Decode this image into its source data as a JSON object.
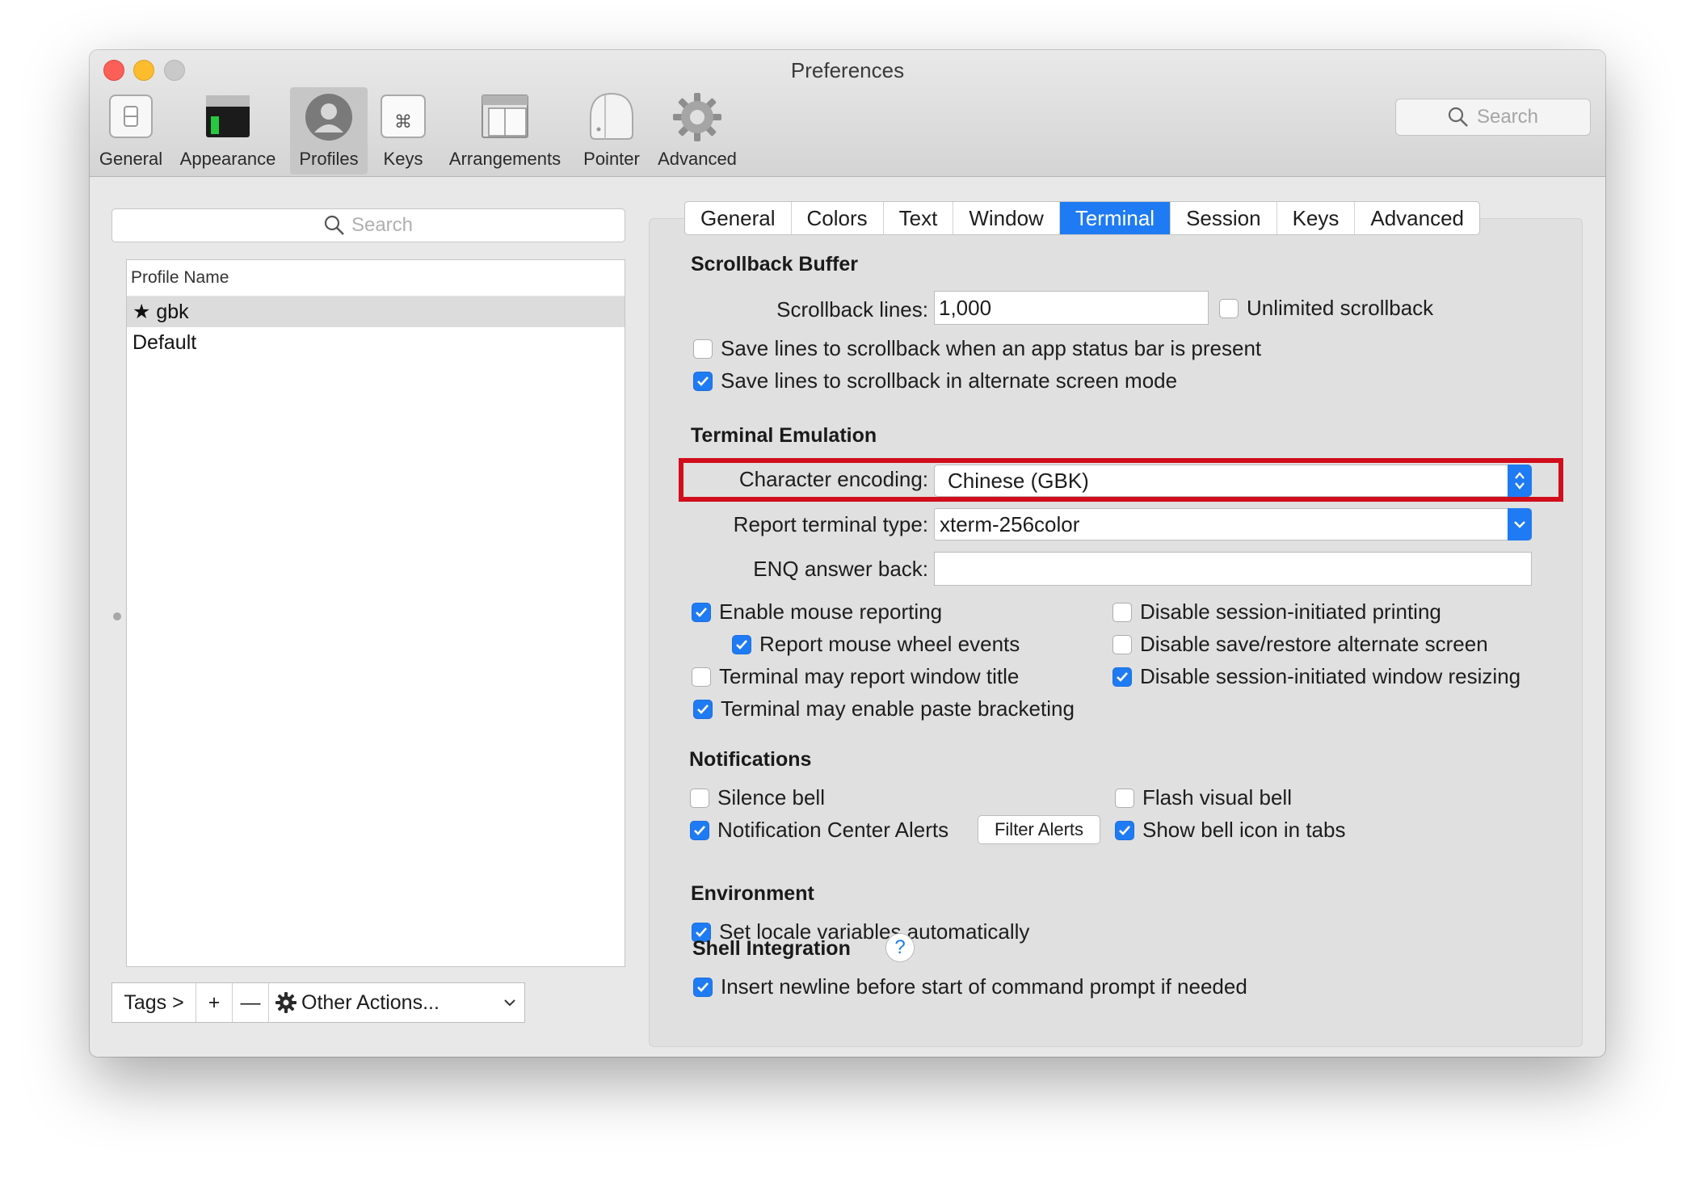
{
  "window": {
    "title": "Preferences"
  },
  "toolbar": {
    "items": [
      {
        "label": "General",
        "icon": "general-switch-icon"
      },
      {
        "label": "Appearance",
        "icon": "appearance-window-icon"
      },
      {
        "label": "Profiles",
        "icon": "profile-user-icon"
      },
      {
        "label": "Keys",
        "icon": "command-key-icon"
      },
      {
        "label": "Arrangements",
        "icon": "arrangements-windows-icon"
      },
      {
        "label": "Pointer",
        "icon": "mouse-icon"
      },
      {
        "label": "Advanced",
        "icon": "gear-icon"
      }
    ],
    "active": "Profiles",
    "search_placeholder": "Search"
  },
  "profiles": {
    "search_placeholder": "Search",
    "column_header": "Profile Name",
    "rows": [
      {
        "name": "★ gbk",
        "selected": true
      },
      {
        "name": "Default",
        "selected": false
      }
    ],
    "bottom": {
      "tags": "Tags >",
      "add": "+",
      "remove": "—",
      "other_actions": "Other Actions..."
    }
  },
  "tabs": [
    "General",
    "Colors",
    "Text",
    "Window",
    "Terminal",
    "Session",
    "Keys",
    "Advanced"
  ],
  "active_tab": "Terminal",
  "scrollback": {
    "heading": "Scrollback Buffer",
    "lines_label": "Scrollback lines:",
    "lines_value": "1,000",
    "unlimited": {
      "label": "Unlimited scrollback",
      "checked": false
    },
    "status_bar": {
      "label": "Save lines to scrollback when an app status bar is present",
      "checked": false
    },
    "alternate": {
      "label": "Save lines to scrollback in alternate screen mode",
      "checked": true
    }
  },
  "emulation": {
    "heading": "Terminal Emulation",
    "encoding_label": "Character encoding:",
    "encoding_value": "Chinese (GBK)",
    "terminal_type_label": "Report terminal type:",
    "terminal_type_value": "xterm-256color",
    "enq_label": "ENQ answer back:",
    "enq_value": "",
    "options_left": [
      {
        "label": "Enable mouse reporting",
        "checked": true
      },
      {
        "label": "Report mouse wheel events",
        "checked": true
      },
      {
        "label": "Terminal may report window title",
        "checked": false
      },
      {
        "label": "Terminal may enable paste bracketing",
        "checked": true
      }
    ],
    "options_right": [
      {
        "label": "Disable session-initiated printing",
        "checked": false
      },
      {
        "label": "Disable save/restore alternate screen",
        "checked": false
      },
      {
        "label": "Disable session-initiated window resizing",
        "checked": true
      }
    ]
  },
  "notifications": {
    "heading": "Notifications",
    "silence_bell": {
      "label": "Silence bell",
      "checked": false
    },
    "center_alerts": {
      "label": "Notification Center Alerts",
      "checked": true
    },
    "filter_alerts": "Filter Alerts",
    "flash_bell": {
      "label": "Flash visual bell",
      "checked": false
    },
    "bell_icon": {
      "label": "Show bell icon in tabs",
      "checked": true
    }
  },
  "environment": {
    "heading": "Environment",
    "locale": {
      "label": "Set locale variables automatically",
      "checked": true
    }
  },
  "shell_integration": {
    "heading": "Shell Integration",
    "help": "?",
    "newline": {
      "label": "Insert newline before start of command prompt if needed",
      "checked": true
    }
  },
  "colors": {
    "accent": "#1f7bf3",
    "highlight_border": "#d10d1c",
    "close": "#fc5f57",
    "minimize": "#fdbc2e",
    "zoom": "#c9c9c9"
  }
}
